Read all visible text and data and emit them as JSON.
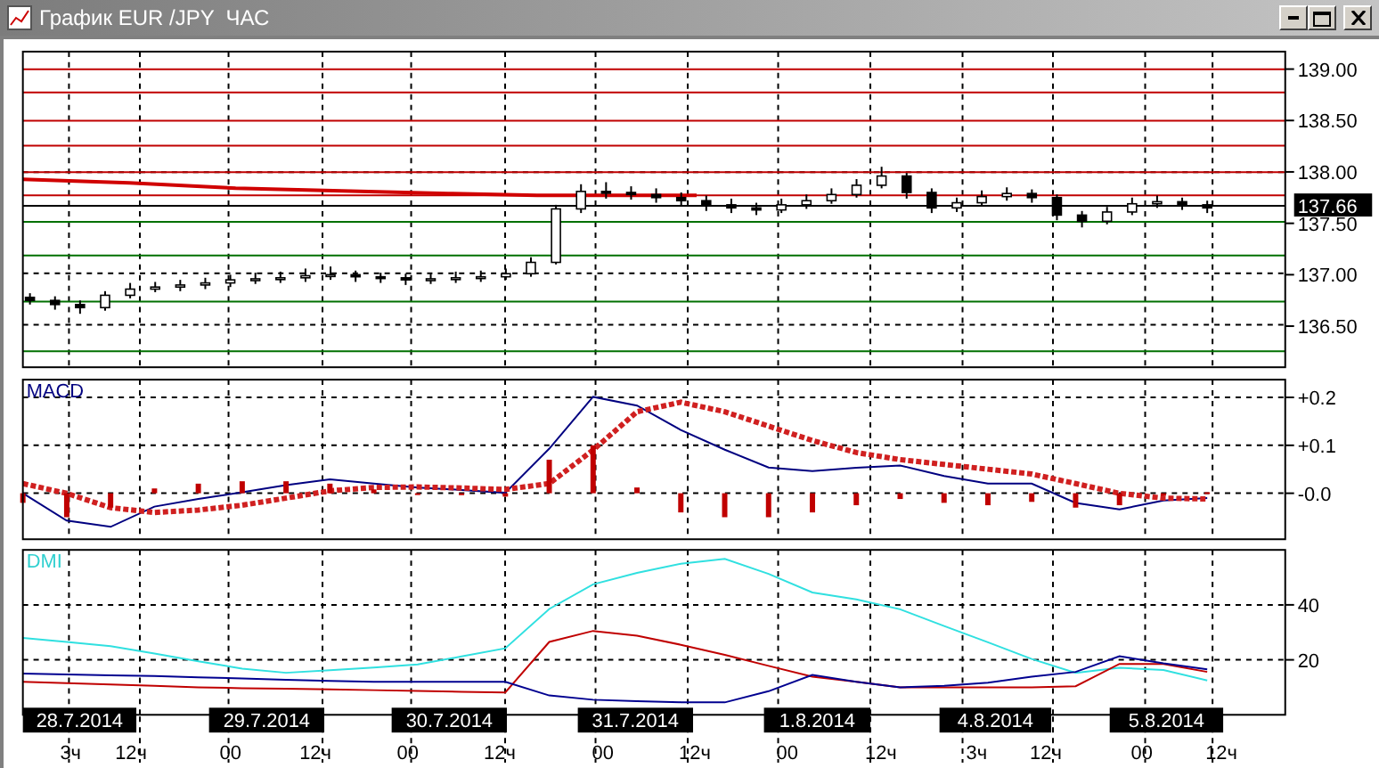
{
  "window": {
    "title": "График EUR /JPY  ЧАС"
  },
  "price_panel": {
    "chart_data": {
      "type": "candlestick",
      "ylim": [
        136.1,
        139.17
      ],
      "yticks": [
        {
          "value": 139,
          "label": "139.00"
        },
        {
          "value": 138.5,
          "label": "138.50"
        },
        {
          "value": 138,
          "label": "138.00"
        },
        {
          "value": 137.5,
          "label": "137.50"
        },
        {
          "value": 137,
          "label": "137.00"
        },
        {
          "value": 136.5,
          "label": "136.50"
        }
      ],
      "ohlc": [
        [
          136.78,
          136.82,
          136.71,
          136.75
        ],
        [
          136.75,
          136.79,
          136.66,
          136.71
        ],
        [
          136.71,
          136.75,
          136.62,
          136.68
        ],
        [
          136.68,
          136.84,
          136.65,
          136.8
        ],
        [
          136.8,
          136.92,
          136.77,
          136.86
        ],
        [
          136.86,
          136.93,
          136.83,
          136.88
        ],
        [
          136.88,
          136.95,
          136.84,
          136.9
        ],
        [
          136.9,
          136.97,
          136.86,
          136.92
        ],
        [
          136.92,
          137.0,
          136.88,
          136.95
        ],
        [
          136.95,
          137.02,
          136.91,
          136.96
        ],
        [
          136.96,
          137.03,
          136.92,
          136.97
        ],
        [
          136.97,
          137.06,
          136.93,
          136.99
        ],
        [
          136.99,
          137.08,
          136.95,
          137.0
        ],
        [
          137.0,
          137.04,
          136.93,
          136.98
        ],
        [
          136.98,
          137.02,
          136.92,
          136.97
        ],
        [
          136.97,
          137.01,
          136.9,
          136.95
        ],
        [
          136.95,
          137.01,
          136.91,
          136.96
        ],
        [
          136.96,
          137.03,
          136.92,
          136.97
        ],
        [
          136.97,
          137.04,
          136.93,
          136.98
        ],
        [
          136.98,
          137.06,
          136.95,
          137.01
        ],
        [
          137.01,
          137.17,
          136.98,
          137.12
        ],
        [
          137.12,
          137.68,
          137.1,
          137.64
        ],
        [
          137.64,
          137.88,
          137.6,
          137.81
        ],
        [
          137.81,
          137.9,
          137.74,
          137.8
        ],
        [
          137.8,
          137.86,
          137.73,
          137.78
        ],
        [
          137.78,
          137.84,
          137.7,
          137.75
        ],
        [
          137.75,
          137.8,
          137.67,
          137.72
        ],
        [
          137.72,
          137.77,
          137.62,
          137.68
        ],
        [
          137.68,
          137.74,
          137.6,
          137.65
        ],
        [
          137.65,
          137.7,
          137.58,
          137.63
        ],
        [
          137.63,
          137.74,
          137.6,
          137.68
        ],
        [
          137.68,
          137.78,
          137.64,
          137.72
        ],
        [
          137.72,
          137.84,
          137.69,
          137.78
        ],
        [
          137.78,
          137.93,
          137.75,
          137.87
        ],
        [
          137.87,
          138.05,
          137.84,
          137.96
        ],
        [
          137.96,
          137.99,
          137.74,
          137.8
        ],
        [
          137.8,
          137.84,
          137.6,
          137.65
        ],
        [
          137.65,
          137.75,
          137.61,
          137.7
        ],
        [
          137.7,
          137.82,
          137.67,
          137.76
        ],
        [
          137.76,
          137.85,
          137.72,
          137.79
        ],
        [
          137.79,
          137.83,
          137.7,
          137.75
        ],
        [
          137.75,
          137.78,
          137.53,
          137.58
        ],
        [
          137.58,
          137.62,
          137.46,
          137.52
        ],
        [
          137.52,
          137.66,
          137.49,
          137.61
        ],
        [
          137.61,
          137.75,
          137.58,
          137.69
        ],
        [
          137.69,
          137.77,
          137.65,
          137.71
        ],
        [
          137.71,
          137.75,
          137.63,
          137.68
        ],
        [
          137.68,
          137.72,
          137.6,
          137.65
        ]
      ]
    },
    "current_price": "137.66"
  },
  "macd_panel": {
    "chart_data": {
      "type": "line",
      "title": "MACD",
      "ylim": [
        -0.096,
        0.237
      ],
      "yticks": [
        {
          "value": 0.2,
          "label": "+0.2"
        },
        {
          "value": 0.1,
          "label": "+0.1"
        },
        {
          "value": 0,
          "label": "-0.0"
        }
      ],
      "series": [
        {
          "color": "#000080",
          "values": [
            0.0,
            -0.057,
            -0.07,
            -0.028,
            -0.012,
            0.002,
            0.017,
            0.029,
            0.02,
            0.012,
            0.007,
            0.001,
            0.093,
            0.201,
            0.183,
            0.132,
            0.091,
            0.054,
            0.046,
            0.053,
            0.058,
            0.036,
            0.02,
            0.02,
            -0.02,
            -0.034,
            -0.015,
            -0.01
          ]
        },
        {
          "color": "#d02020",
          "line_style": "dotted",
          "values": [
            0.02,
            0.0,
            -0.03,
            -0.04,
            -0.035,
            -0.025,
            -0.01,
            0.005,
            0.012,
            0.013,
            0.011,
            0.008,
            0.02,
            0.09,
            0.17,
            0.19,
            0.17,
            0.14,
            0.11,
            0.085,
            0.07,
            0.06,
            0.05,
            0.04,
            0.02,
            0.0,
            -0.01,
            -0.012
          ]
        },
        {
          "color": "#c00000",
          "type": "bar",
          "values": [
            -0.02,
            -0.05,
            -0.03,
            0.01,
            0.02,
            0.025,
            0.025,
            0.02,
            0.008,
            0,
            -0.004,
            -0.007,
            0.07,
            0.1,
            0.012,
            -0.04,
            -0.05,
            -0.05,
            -0.04,
            -0.025,
            -0.012,
            -0.02,
            -0.025,
            -0.018,
            -0.03,
            -0.025,
            -0.005,
            0.002
          ]
        }
      ]
    }
  },
  "dmi_panel": {
    "chart_data": {
      "type": "line",
      "title": "DMI",
      "ylim": [
        0,
        60
      ],
      "yticks": [
        {
          "value": 40,
          "label": "40"
        },
        {
          "value": 20,
          "label": "20"
        }
      ],
      "series": [
        {
          "color": "#30e0e0",
          "values": [
            28,
            26.5,
            25,
            22.3,
            19.5,
            16.8,
            15.3,
            16.2,
            17.2,
            18.3,
            21.2,
            24.2,
            38.5,
            47.5,
            51.6,
            55,
            56.7,
            51.3,
            44.5,
            42,
            38.4,
            32.3,
            26.4,
            20.3,
            15.3,
            17.1,
            16.3,
            12.5
          ]
        },
        {
          "color": "#c00000",
          "values": [
            12,
            11.5,
            11,
            10.5,
            10,
            9.7,
            9.5,
            9.2,
            9,
            8.7,
            8.4,
            8.1,
            26.5,
            30.5,
            28.8,
            25.5,
            21.8,
            17.8,
            13.9,
            12,
            10,
            10,
            10,
            10,
            10.4,
            18.5,
            18.5,
            15.6
          ]
        },
        {
          "color": "#000090",
          "values": [
            15,
            14.7,
            14.4,
            14.1,
            13.6,
            13.2,
            12.8,
            12.3,
            12,
            12,
            12,
            12,
            7,
            5.5,
            5,
            4.6,
            4.5,
            8.6,
            14.5,
            12,
            10,
            10.6,
            11.7,
            13.9,
            15.6,
            21.3,
            18.7,
            16.6
          ]
        }
      ]
    }
  },
  "time_axis": {
    "dates": [
      "28.7.2014",
      "29.7.2014",
      "30.7.2014",
      "31.7.2014",
      "1.8.2014",
      "4.8.2014",
      "5.8.2014"
    ],
    "hours": [
      "3ч",
      "12ч",
      "00",
      "12ч",
      "00",
      "12ч",
      "00",
      "12ч",
      "00",
      "12ч",
      "3ч",
      "12ч",
      "00",
      "12ч"
    ]
  }
}
